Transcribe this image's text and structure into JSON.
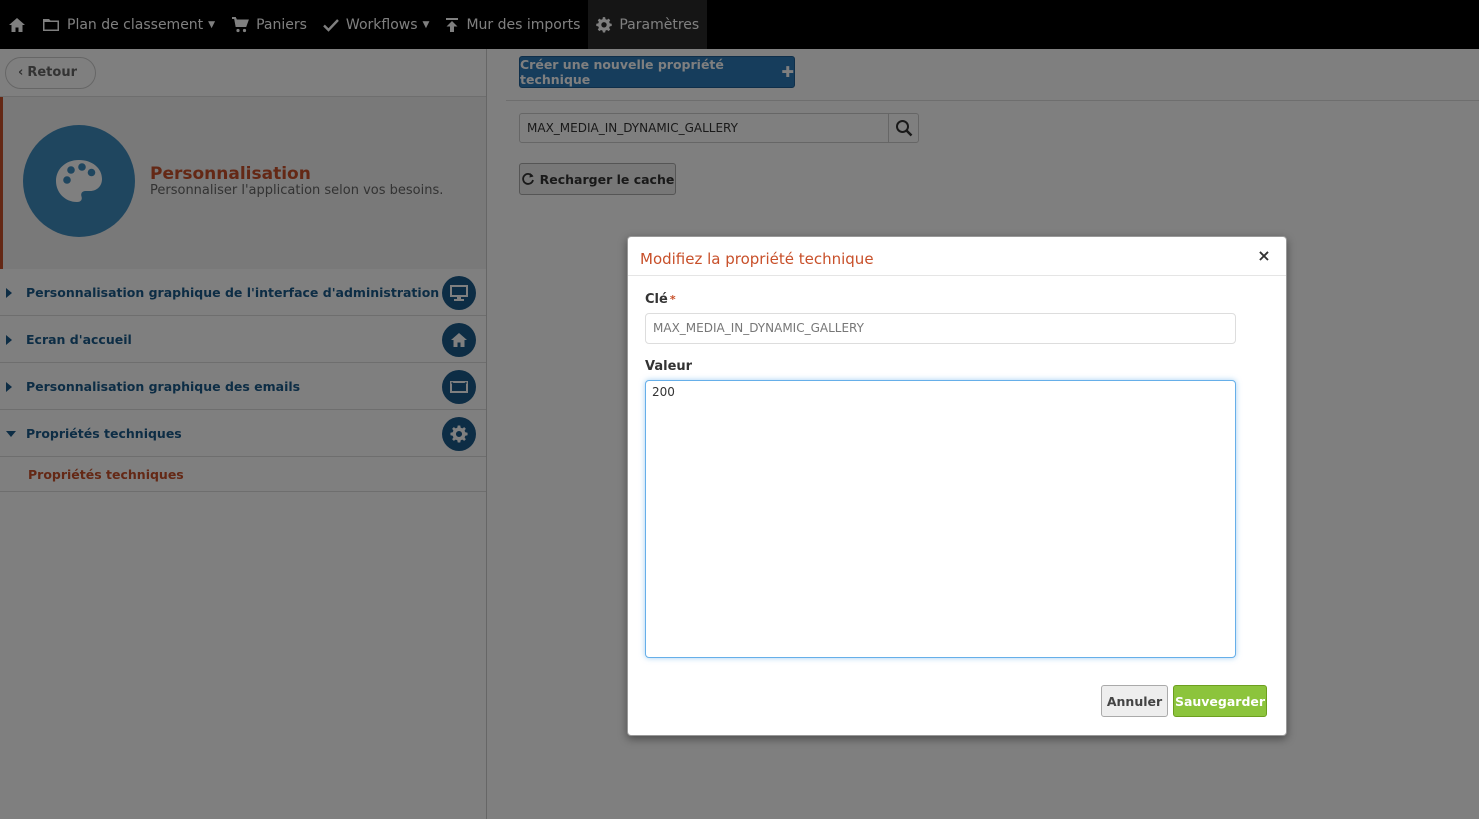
{
  "nav": {
    "plan_label": "Plan de classement",
    "paniers_label": "Paniers",
    "workflows_label": "Workflows",
    "imports_label": "Mur des imports",
    "params_label": "Paramètres"
  },
  "left": {
    "back_label": "Retour",
    "hero_title": "Personnalisation",
    "hero_subtitle": "Personnaliser l'application selon vos besoins.",
    "menu": [
      {
        "label": "Personnalisation graphique de l'interface d'administration",
        "icon": "monitor-icon"
      },
      {
        "label": "Ecran d'accueil",
        "icon": "home-icon"
      },
      {
        "label": "Personnalisation graphique des emails",
        "icon": "envelope-icon"
      },
      {
        "label": "Propriétés techniques",
        "icon": "gear-icon"
      }
    ],
    "submenu_active": "Propriétés techniques"
  },
  "main": {
    "create_label": "Créer une nouvelle propriété technique",
    "search_value": "MAX_MEDIA_IN_DYNAMIC_GALLERY",
    "reload_label": "Recharger le cache"
  },
  "modal": {
    "title": "Modifiez la propriété technique",
    "close": "×",
    "key_label": "Clé",
    "required_mark": "*",
    "key_value": "MAX_MEDIA_IN_DYNAMIC_GALLERY",
    "value_label": "Valeur",
    "value_text": "200",
    "cancel_label": "Annuler",
    "save_label": "Sauvegarder"
  },
  "colors": {
    "accent": "#c8502a",
    "primary": "#2d7ab8",
    "menu_blue": "#1a5a8a",
    "success": "#8cc43c",
    "topbar": "#000000"
  }
}
